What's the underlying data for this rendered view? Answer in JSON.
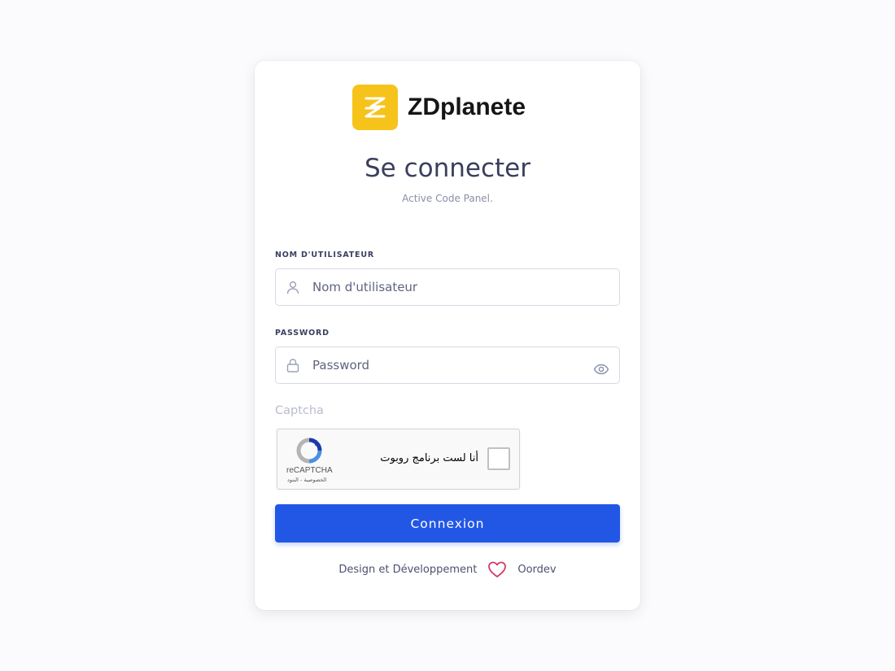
{
  "brand": {
    "name": "ZDplanete",
    "logo_icon": "zd-logo-icon",
    "logo_color": "#f6c31a"
  },
  "login": {
    "title": "Se connecter",
    "subtitle": "Active Code Panel."
  },
  "form": {
    "username": {
      "label": "NOM D'UTILISATEUR",
      "placeholder": "Nom d'utilisateur",
      "value": "",
      "icon": "user-icon"
    },
    "password": {
      "label": "PASSWORD",
      "placeholder": "Password",
      "value": "",
      "icon": "lock-icon",
      "toggle_icon": "eye-icon"
    },
    "captcha": {
      "label": "Captcha",
      "checkbox_text": "أنا لست برنامج روبوت",
      "brand": "reCAPTCHA",
      "links": "الخصوصية - البنود"
    },
    "submit_label": "Connexion"
  },
  "footer": {
    "prefix": "Design et Développement",
    "heart_icon": "heart-icon",
    "author": "Oordev"
  },
  "colors": {
    "primary": "#2257e6",
    "text": "#3a3f5c",
    "muted": "#8a8fa8",
    "heart": "#d03b67"
  }
}
